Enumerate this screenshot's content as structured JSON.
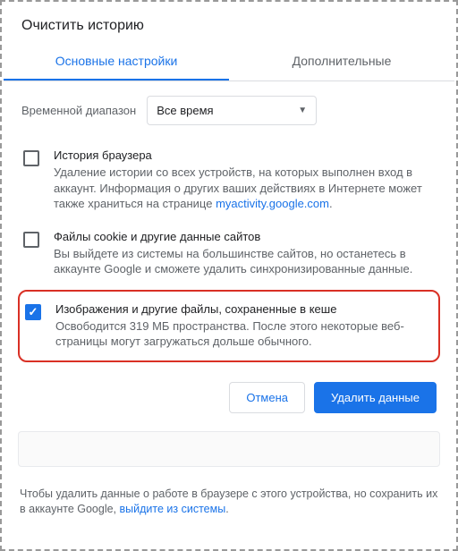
{
  "title": "Очистить историю",
  "tabs": {
    "basic": "Основные настройки",
    "advanced": "Дополнительные"
  },
  "time": {
    "label": "Временной диапазон",
    "value": "Все время"
  },
  "options": {
    "history": {
      "title": "История браузера",
      "desc_before": "Удаление истории со всех устройств, на которых выполнен вход в аккаунт. Информация о других ваших действиях в Интернете может также храниться на странице ",
      "link": "myactivity.google.com",
      "desc_after": "."
    },
    "cookies": {
      "title": "Файлы cookie и другие данные сайтов",
      "desc": "Вы выйдете из системы на большинстве сайтов, но останетесь в аккаунте Google и сможете удалить синхронизированные данные."
    },
    "cache": {
      "title": "Изображения и другие файлы, сохраненные в кеше",
      "desc": "Освободится 319 МБ пространства. После этого некоторые веб-страницы могут загружаться дольше обычного."
    }
  },
  "buttons": {
    "cancel": "Отмена",
    "confirm": "Удалить данные"
  },
  "footer": {
    "before": "Чтобы удалить данные о работе в браузере с этого устройства, но сохранить их в аккаунте Google, ",
    "link": "выйдите из системы",
    "after": "."
  }
}
